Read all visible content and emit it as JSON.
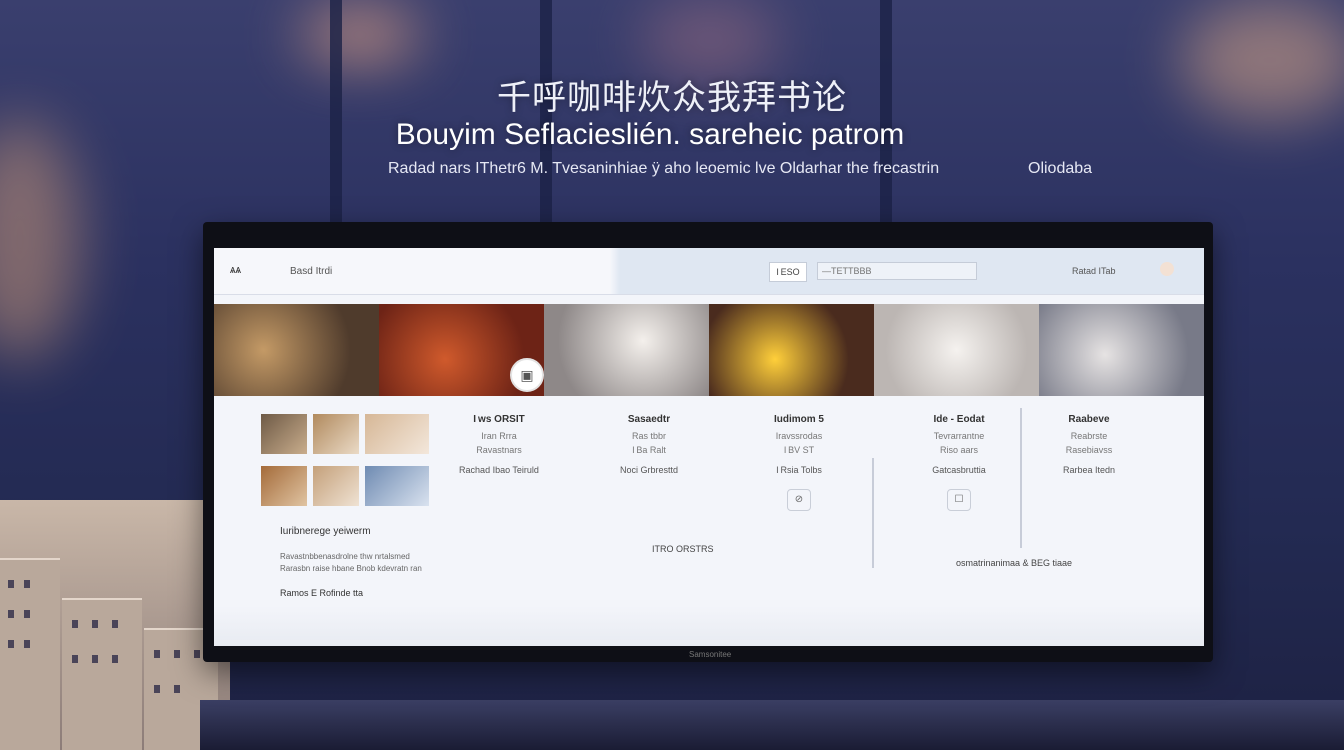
{
  "hero": {
    "headline_cn": "千呼咖啡炊众我拜书论",
    "title": "Bouyim Seflacieslién. sareheic patrom",
    "subtitle": "Radad nars IThetr6 M. Tvesaninhiae ÿ aho leoemic lve Oldarhar the frecastrin",
    "side_text": "Oliodaba"
  },
  "app": {
    "logo": "ѧѧ",
    "name": "Basd Itrdi",
    "search_button": "I ESO",
    "search_placeholder": "—ТЕТТВВВ",
    "account": "Ratad ITab",
    "monitor_brand": "Samsonitee"
  },
  "banner": {
    "play_badge": "▣"
  },
  "left_panel": {
    "heading": "Iuribnerege yeiwerm",
    "line": "Ravastnbbenasdrolne thw nrtalsmed",
    "line2": "Rarasbn raise hbane Bnob kdevratn ran",
    "footer": "Ramos E Rofinde tta"
  },
  "columns": [
    {
      "title": "I ws ORSIT",
      "line1": "Iran Rrra",
      "line2": "Ravastnars",
      "action": "Rachad Ibao Teiruld",
      "icon": ""
    },
    {
      "title": "Sasaedtr",
      "line1": "Ras tbbr",
      "line2": "I Ba Ralt",
      "action": "Noci Grbresttd",
      "icon": ""
    },
    {
      "title": "Iudimom 5",
      "line1": "Iravssrodas",
      "line2": "I BV ST",
      "action": "I Rsia Tolbs",
      "icon": "⊘"
    },
    {
      "title": "Ide - Eodat",
      "line1": "Tevrarrantne",
      "line2": "Riso aars",
      "action": "Gatcasbruttia",
      "icon": "☐"
    },
    {
      "title": "Raabeve",
      "line1": "Reabrste",
      "line2": "Rasebiavss",
      "action": "Rarbea Itedn",
      "icon": ""
    }
  ],
  "extra_text": {
    "mid_link": "ITRO ORSTRS",
    "right_link": "osmatrinanimaa & BEG tiaae"
  }
}
